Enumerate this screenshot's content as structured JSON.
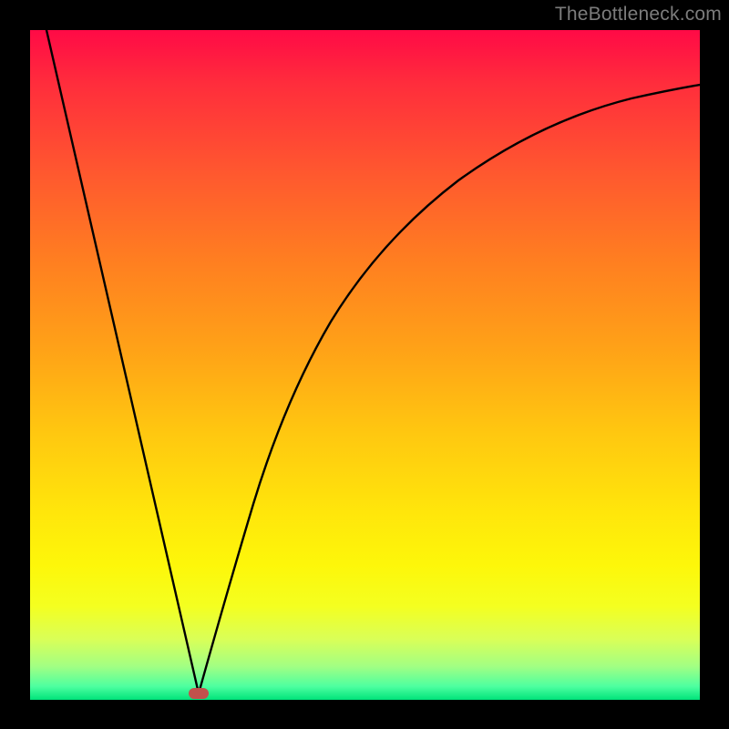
{
  "watermark": "TheBottleneck.com",
  "marker": {
    "x_frac": 0.252,
    "y_frac": 0.991,
    "color": "#c1514c"
  },
  "chart_data": {
    "type": "line",
    "title": "",
    "xlabel": "",
    "ylabel": "",
    "xlim": [
      0,
      1
    ],
    "ylim": [
      0,
      1
    ],
    "series": [
      {
        "name": "left-branch",
        "x": [
          0.024,
          0.252
        ],
        "y": [
          1.0,
          0.0
        ]
      },
      {
        "name": "right-branch",
        "x": [
          0.252,
          0.3,
          0.35,
          0.4,
          0.45,
          0.5,
          0.55,
          0.6,
          0.65,
          0.7,
          0.75,
          0.8,
          0.85,
          0.9,
          0.95,
          1.0
        ],
        "y": [
          0.0,
          0.225,
          0.4,
          0.53,
          0.63,
          0.7,
          0.755,
          0.795,
          0.825,
          0.85,
          0.87,
          0.885,
          0.895,
          0.905,
          0.912,
          0.918
        ]
      }
    ],
    "annotations": [
      {
        "type": "marker",
        "x": 0.252,
        "y": 0.0,
        "shape": "pill",
        "color": "#c1514c"
      }
    ]
  }
}
